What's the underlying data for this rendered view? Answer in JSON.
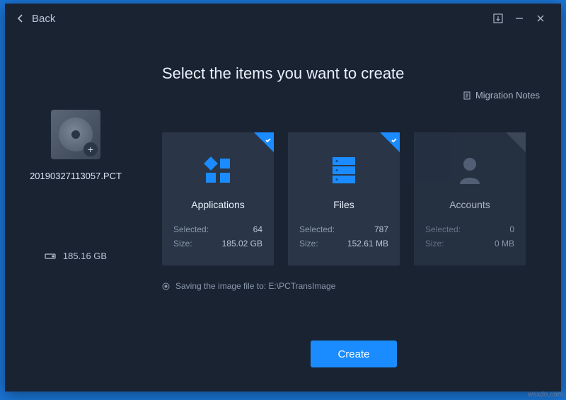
{
  "titlebar": {
    "back_label": "Back"
  },
  "sidebar": {
    "filename": "20190327113057.PCT",
    "total_size": "185.16 GB",
    "badge_glyph": "+"
  },
  "main": {
    "title": "Select the items you want to create",
    "migration_notes_label": "Migration Notes",
    "save_path_label": "Saving the image file to: E:\\PCTransImage",
    "create_button_label": "Create"
  },
  "cards": [
    {
      "title": "Applications",
      "selected_label": "Selected:",
      "selected_value": "64",
      "size_label": "Size:",
      "size_value": "185.02 GB",
      "checked": true
    },
    {
      "title": "Files",
      "selected_label": "Selected:",
      "selected_value": "787",
      "size_label": "Size:",
      "size_value": "152.61 MB",
      "checked": true
    },
    {
      "title": "Accounts",
      "selected_label": "Selected:",
      "selected_value": "0",
      "size_label": "Size:",
      "size_value": "0 MB",
      "checked": false
    }
  ],
  "watermark": "wsxdn.com"
}
